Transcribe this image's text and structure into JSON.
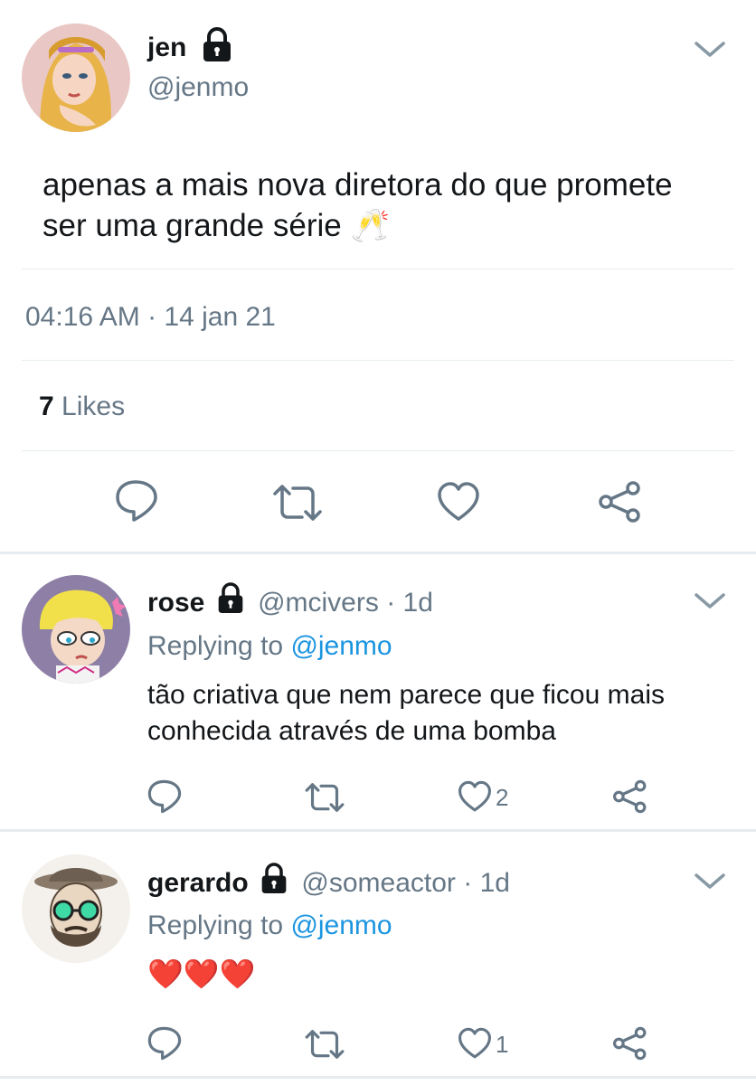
{
  "main_tweet": {
    "display_name": "jen",
    "handle": "@jenmo",
    "text": "apenas a mais nova diretora do que promete ser uma grande série 🥂",
    "timestamp": "04:16 AM · 14 jan 21",
    "likes_count": "7",
    "likes_label": "Likes"
  },
  "replies": [
    {
      "display_name": "rose",
      "handle": "@mcivers",
      "age": "· 1d",
      "replying_prefix": "Replying to",
      "replying_handle": "@jenmo",
      "text": "tão criativa que nem parece que ficou mais conhecida através de uma bomba",
      "like_count": "2"
    },
    {
      "display_name": "gerardo",
      "handle": "@someactor",
      "age": "· 1d",
      "replying_prefix": "Replying to",
      "replying_handle": "@jenmo",
      "text": "❤️❤️❤️",
      "like_count": "1"
    }
  ],
  "colors": {
    "accent": "#1b95e0",
    "muted": "#657786",
    "divider": "#e6ecf0"
  },
  "icons": [
    "lock-icon",
    "chevron-down-icon",
    "reply-icon",
    "retweet-icon",
    "like-icon",
    "share-icon"
  ]
}
